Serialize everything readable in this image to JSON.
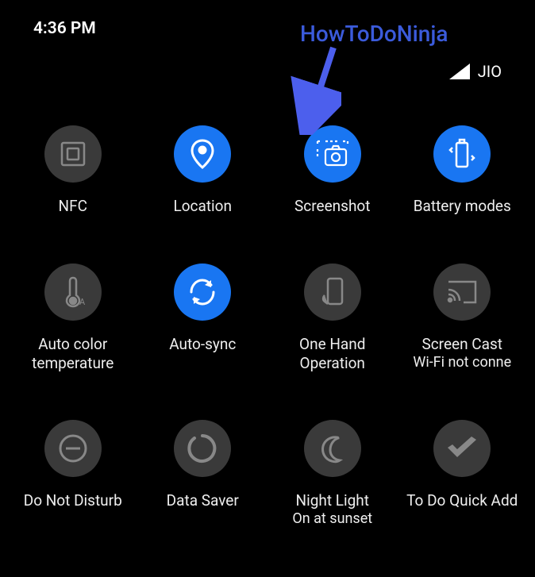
{
  "status": {
    "time": "4:36 PM",
    "carrier": "JIO"
  },
  "annotation": {
    "watermark": "HowToDoNinja"
  },
  "tiles": [
    {
      "label": "NFC",
      "sublabel": "",
      "active": false,
      "icon": "nfc"
    },
    {
      "label": "Location",
      "sublabel": "",
      "active": true,
      "icon": "location"
    },
    {
      "label": "Screenshot",
      "sublabel": "",
      "active": true,
      "icon": "screenshot"
    },
    {
      "label": "Battery modes",
      "sublabel": "",
      "active": true,
      "icon": "battery"
    },
    {
      "label": "Auto color temperature",
      "sublabel": "",
      "active": false,
      "icon": "thermometer"
    },
    {
      "label": "Auto-sync",
      "sublabel": "",
      "active": true,
      "icon": "sync"
    },
    {
      "label": "One Hand Operation",
      "sublabel": "",
      "active": false,
      "icon": "onehand"
    },
    {
      "label": "Screen Cast",
      "sublabel": "Wi-Fi not conne",
      "active": false,
      "icon": "cast"
    },
    {
      "label": "Do Not Disturb",
      "sublabel": "",
      "active": false,
      "icon": "dnd"
    },
    {
      "label": "Data Saver",
      "sublabel": "",
      "active": false,
      "icon": "datasaver"
    },
    {
      "label": "Night Light",
      "sublabel": "On at sunset",
      "active": false,
      "icon": "moon"
    },
    {
      "label": "To Do Quick Add",
      "sublabel": "",
      "active": false,
      "icon": "todo"
    }
  ]
}
